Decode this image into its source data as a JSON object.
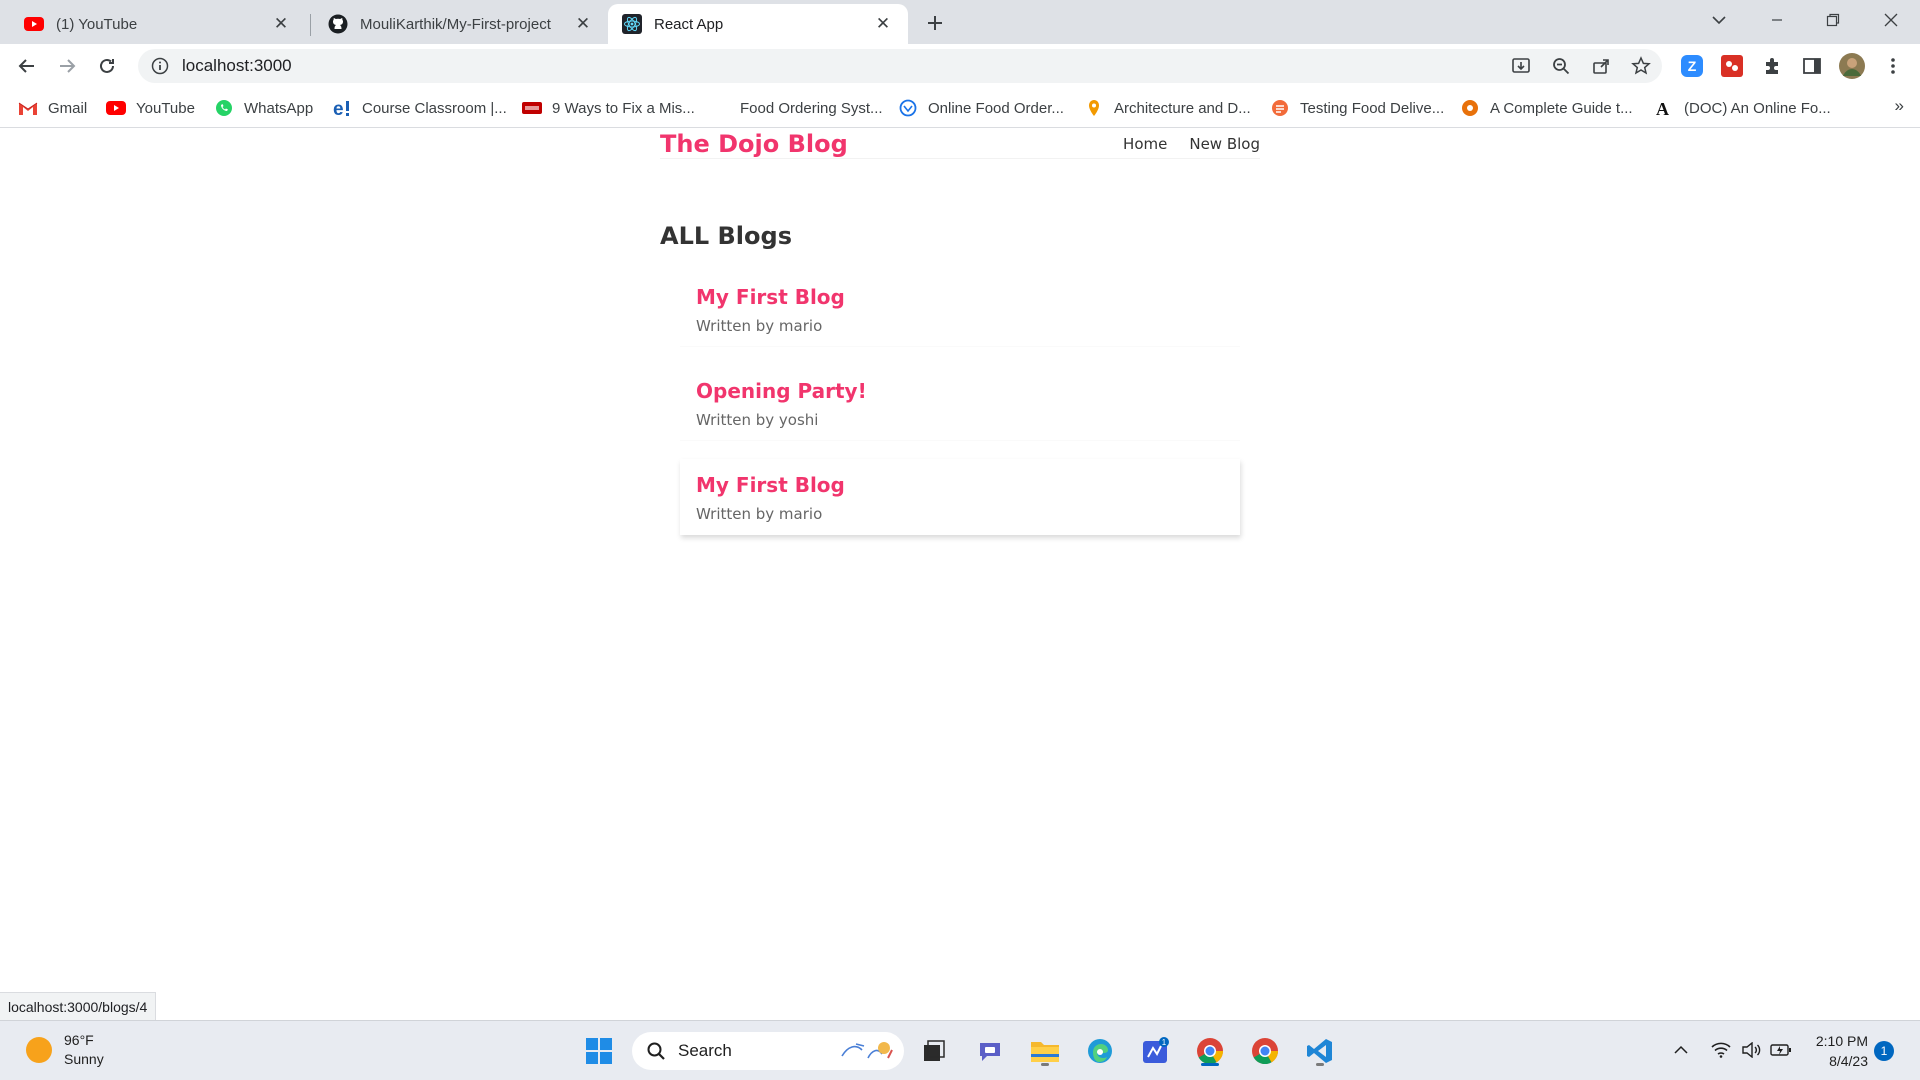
{
  "browser": {
    "tabs": [
      {
        "title": "(1) YouTube",
        "icon": "youtube-icon",
        "active": false
      },
      {
        "title": "MouliKarthik/My-First-project",
        "icon": "github-icon",
        "active": false
      },
      {
        "title": "React App",
        "icon": "react-icon",
        "active": true
      }
    ],
    "url": "localhost:3000",
    "bookmarks": [
      {
        "label": "Gmail",
        "icon": "gmail-icon"
      },
      {
        "label": "YouTube",
        "icon": "youtube-icon"
      },
      {
        "label": "WhatsApp",
        "icon": "whatsapp-icon"
      },
      {
        "label": "Course Classroom |...",
        "icon": "edureka-icon"
      },
      {
        "label": "9 Ways to Fix a Mis...",
        "icon": "article-icon"
      },
      {
        "label": "Food Ordering Syst...",
        "icon": "none"
      },
      {
        "label": "Online Food Order...",
        "icon": "globe-icon"
      },
      {
        "label": "Architecture and D...",
        "icon": "site-icon"
      },
      {
        "label": "Testing Food Delive...",
        "icon": "site-icon"
      },
      {
        "label": "A Complete Guide t...",
        "icon": "site-icon"
      },
      {
        "label": "(DOC) An Online Fo...",
        "icon": "academia-icon"
      }
    ],
    "status_url": "localhost:3000/blogs/4"
  },
  "app": {
    "brand": "The Dojo Blog",
    "nav": {
      "home": "Home",
      "new_blog": "New Blog"
    },
    "heading": "ALL Blogs",
    "blogs": [
      {
        "title": "My First Blog",
        "byline": "Written by mario"
      },
      {
        "title": "Opening Party!",
        "byline": "Written by yoshi"
      },
      {
        "title": "My First Blog",
        "byline": "Written by mario"
      }
    ]
  },
  "taskbar": {
    "weather": {
      "temp": "96°F",
      "condition": "Sunny"
    },
    "search_label": "Search",
    "clock": {
      "time": "2:10 PM",
      "date": "8/4/23"
    },
    "notification_count": "1"
  },
  "colors": {
    "accent": "#f1356d",
    "tabstrip": "#dee1e6"
  }
}
